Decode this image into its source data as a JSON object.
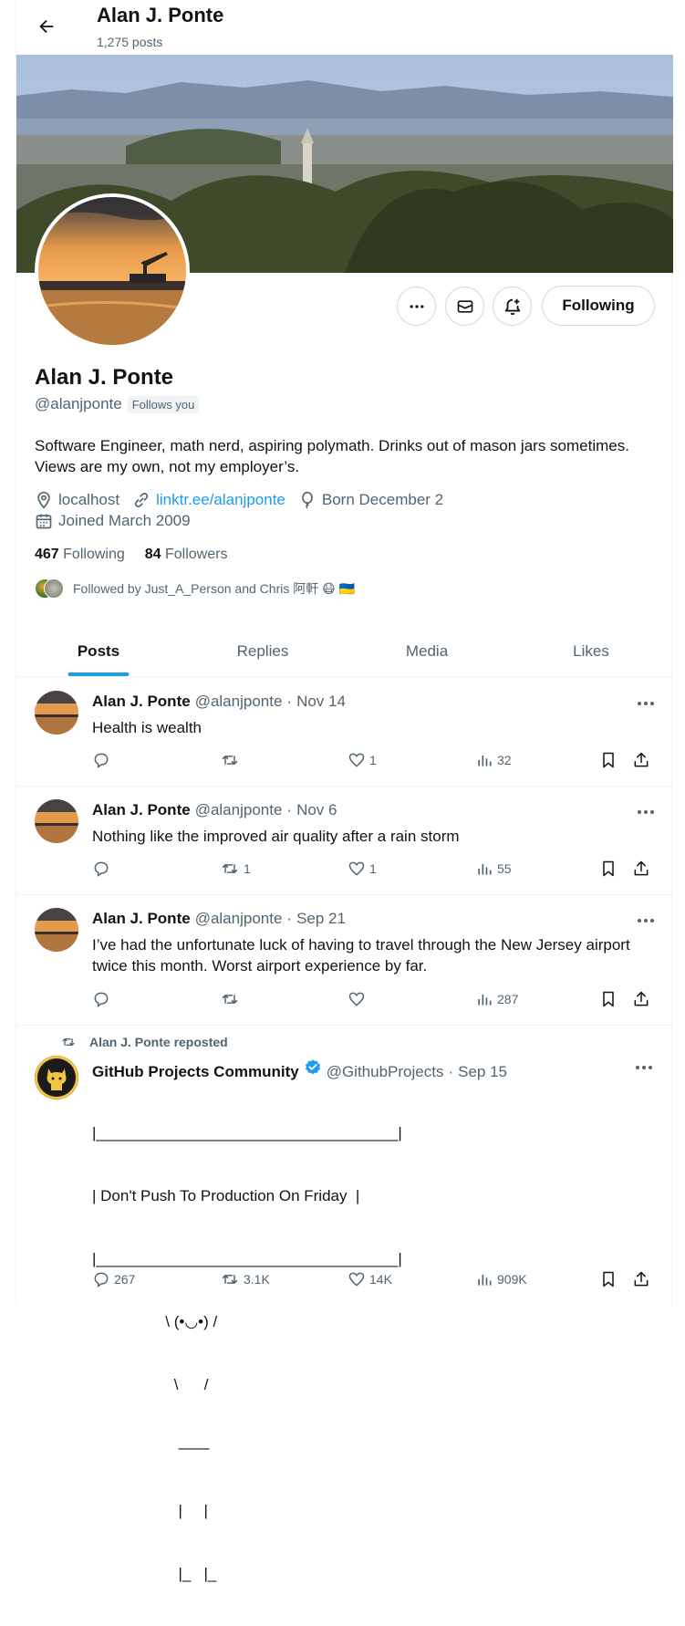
{
  "header": {
    "title": "Alan J. Ponte",
    "post_count": "1,275 posts"
  },
  "profile": {
    "name": "Alan J. Ponte",
    "handle": "@alanjponte",
    "follows_you": "Follows you",
    "bio": "Software Engineer, math nerd, aspiring polymath. Drinks out of mason jars sometimes. Views are my own, not my employer’s.",
    "location": "localhost",
    "website": "linktr.ee/alanjponte",
    "birthday": "Born December 2",
    "joined": "Joined March 2009",
    "following_count": "467",
    "following_label": "Following",
    "followers_count": "84",
    "followers_label": "Followers",
    "followed_by": "Followed by Just_A_Person and Chris 阿軒 😷 🇺🇦",
    "following_button": "Following"
  },
  "tabs": [
    {
      "label": "Posts",
      "active": true
    },
    {
      "label": "Replies",
      "active": false
    },
    {
      "label": "Media",
      "active": false
    },
    {
      "label": "Likes",
      "active": false
    }
  ],
  "posts": [
    {
      "author": "Alan J. Ponte",
      "handle": "@alanjponte",
      "dot": "·",
      "date": "Nov 14",
      "text": "Health is wealth",
      "replies": "",
      "reposts": "",
      "likes": "1",
      "views": "32"
    },
    {
      "author": "Alan J. Ponte",
      "handle": "@alanjponte",
      "dot": "·",
      "date": "Nov 6",
      "text": "Nothing like the improved air quality after a rain storm",
      "replies": "",
      "reposts": "1",
      "likes": "1",
      "views": "55"
    },
    {
      "author": "Alan J. Ponte",
      "handle": "@alanjponte",
      "dot": "·",
      "date": "Sep 21",
      "text": "I’ve had the unfortunate luck of having to travel through the New Jersey airport twice this month. Worst airport experience by far.",
      "replies": "",
      "reposts": "",
      "likes": "",
      "views": "287"
    },
    {
      "repost_label": "Alan J. Ponte reposted",
      "author": "GitHub Projects Community",
      "handle": "@GithubProjects",
      "dot": "·",
      "date": "Sep 15",
      "ascii_lines": [
        "|___________________________________|",
        "| Don't Push To Production On Friday  |",
        "|___________________________________|",
        "                 \\ (•◡•) /",
        "                   \\      /",
        "                    ——",
        "                    |     |",
        "                    |_   |_"
      ],
      "replies": "267",
      "reposts": "3.1K",
      "likes": "14K",
      "views": "909K"
    }
  ],
  "colors": {
    "accent": "#1d9bf0",
    "text": "#0f1419",
    "muted": "#536471",
    "border": "#cfd9de"
  }
}
